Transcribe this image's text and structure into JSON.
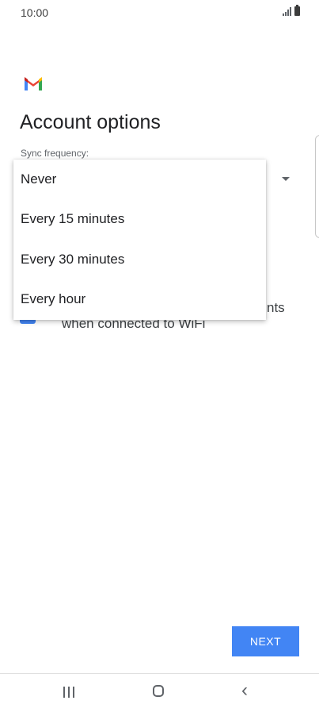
{
  "status_bar": {
    "time": "10:00",
    "icons": [
      "signal-icon",
      "battery-icon"
    ]
  },
  "header": {
    "logo": "gmail-logo",
    "title": "Account options"
  },
  "sync": {
    "label": "Sync frequency:",
    "options": [
      "Never",
      "Every 15 minutes",
      "Every 30 minutes",
      "Every hour"
    ]
  },
  "hidden_row": {
    "text_fragment_1": "nts",
    "text_fragment_2": "when connected to WiFi"
  },
  "actions": {
    "next_label": "NEXT"
  },
  "colors": {
    "accent": "#4285f4",
    "gmail_red": "#ea4335",
    "gmail_blue": "#4285f4",
    "gmail_green": "#34a853",
    "gmail_yellow": "#fbbc04"
  }
}
